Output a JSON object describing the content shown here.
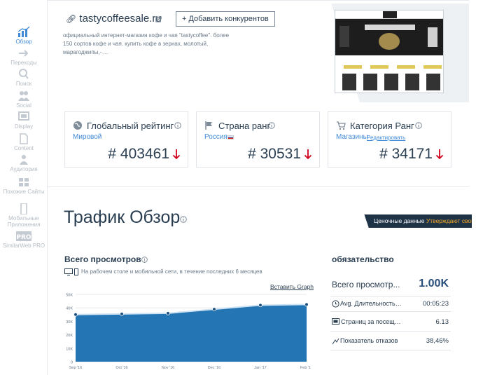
{
  "nav": [
    {
      "label": "Обзор",
      "icon": "chart-bars-icon"
    },
    {
      "label": "Переходы",
      "icon": "referral-arrows-icon"
    },
    {
      "label": "Поиск",
      "icon": "magnifier-icon"
    },
    {
      "label": "Social",
      "icon": "people-icon"
    },
    {
      "label": "Display",
      "icon": "display-ad-icon"
    },
    {
      "label": "Content",
      "icon": "document-icon"
    },
    {
      "label": "Аудитория",
      "icon": "audience-icon"
    },
    {
      "label": "Похожие Сайты",
      "icon": "similar-sites-icon"
    },
    {
      "label": "Мобильные Приложения",
      "icon": "mobile-app-icon"
    },
    {
      "label": "SimilarWeb PRO",
      "icon": "pro-badge-icon"
    }
  ],
  "header": {
    "domain": "tastycoffeesale.ru",
    "add_competitors": "+ Добавить конкурентов",
    "description": "официальный интернет-магазин кофе и чая \"tastycoffee\". более 150 сортов кофе и чая. купить кофе в зернах, молотый, марагоджипы,- ..."
  },
  "cards": [
    {
      "title": "Глобальный рейтинг",
      "sub": "Мировой",
      "value": "# 403461",
      "icon": "globe-icon"
    },
    {
      "title": "Страна ранг",
      "sub": "Россия",
      "value": "# 30531",
      "icon": "flag-icon"
    },
    {
      "title": "Категория Ранг",
      "sub": "Магазины",
      "sub2": "Редактировать",
      "value": "# 34171",
      "icon": "cart-icon"
    }
  ],
  "traffic": {
    "title": "Трафик Обзор",
    "banner_text": "Ценочные данные",
    "banner_link": "Утверждают свой ..."
  },
  "views": {
    "title": "Всего просмотров",
    "subtitle": "На рабочем столе и мобильной сети, в течение последних 6 месяцев",
    "embed": "Вставить Graph"
  },
  "chart_data": {
    "type": "area",
    "x": [
      "Sep '16",
      "Oct '16",
      "Nov '16",
      "Dec '16",
      "Jan '17",
      "Feb '17"
    ],
    "y_ticks": [
      "50K",
      "40K",
      "30K",
      "20K",
      "10K",
      "0"
    ],
    "ylim": [
      0,
      50000
    ],
    "values": [
      35000,
      35500,
      36000,
      39000,
      42000,
      42500
    ],
    "color": "#2475b4",
    "grid": true
  },
  "engagement": {
    "title": "обязательство",
    "rows": [
      {
        "label": "Всего просмотр...",
        "value": "1.00K",
        "icon": ""
      },
      {
        "label": "Avg. Длительность п...",
        "value": "00:05:23",
        "icon": "clock-icon"
      },
      {
        "label": "Страниц за посещен...",
        "value": "6.13",
        "icon": "pages-icon"
      },
      {
        "label": "Показатель отказов",
        "value": "38,46%",
        "icon": "bounce-icon"
      }
    ]
  },
  "colors": {
    "accent": "#3f8ad8",
    "down_arrow": "#d0021b",
    "chart_fill": "#2475b4"
  }
}
